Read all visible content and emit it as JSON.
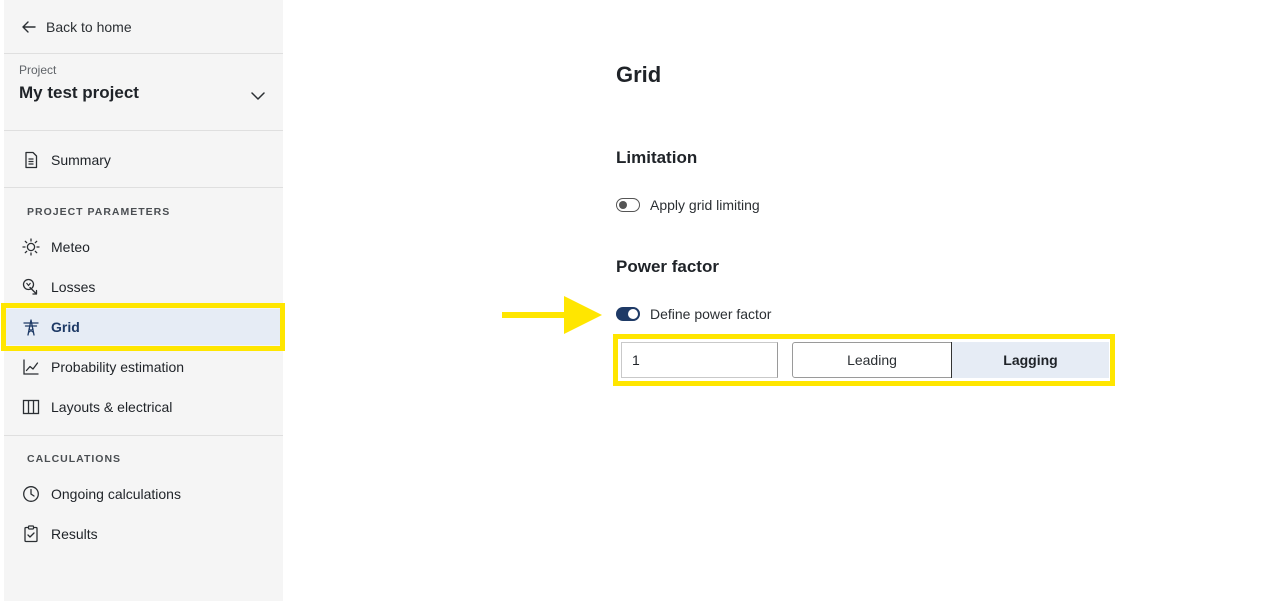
{
  "sidebar": {
    "back_label": "Back to home",
    "project_kicker": "Project",
    "project_name": "My test project",
    "summary_label": "Summary",
    "section_params": "PROJECT PARAMETERS",
    "section_calcs": "CALCULATIONS",
    "items": [
      {
        "label": "Meteo",
        "icon": "sun-icon"
      },
      {
        "label": "Losses",
        "icon": "losses-icon"
      },
      {
        "label": "Grid",
        "icon": "power-pylon-icon",
        "active": true
      },
      {
        "label": "Probability estimation",
        "icon": "chart-line-icon"
      },
      {
        "label": "Layouts & electrical",
        "icon": "layout-columns-icon"
      }
    ],
    "calc_items": [
      {
        "label": "Ongoing calculations",
        "icon": "clock-icon"
      },
      {
        "label": "Results",
        "icon": "clipboard-check-icon"
      }
    ]
  },
  "main": {
    "title": "Grid",
    "limitation": {
      "heading": "Limitation",
      "toggle_label": "Apply grid limiting",
      "enabled": false
    },
    "power_factor": {
      "heading": "Power factor",
      "toggle_label": "Define power factor",
      "enabled": true,
      "value": "1",
      "options": [
        "Leading",
        "Lagging"
      ],
      "selected": "Lagging"
    }
  },
  "colors": {
    "accent": "#1e3a66",
    "active_bg": "#e6ecf5",
    "highlight": "#ffe600",
    "sidebar_bg": "#f5f5f5"
  }
}
